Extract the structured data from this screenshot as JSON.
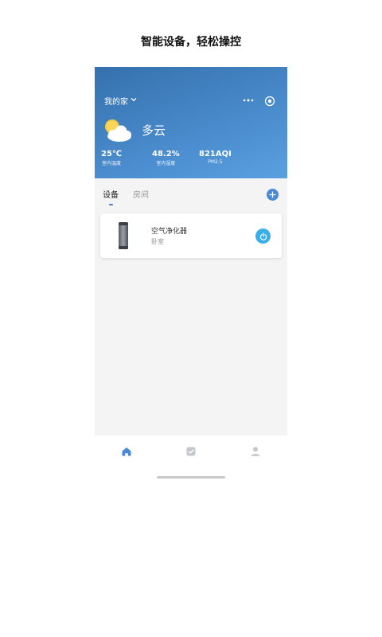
{
  "headline": "智能设备，轻松操控",
  "header": {
    "home_selector": "我的家"
  },
  "weather": {
    "icon": "partly-cloudy-icon",
    "description": "多云",
    "stats": [
      {
        "value": "25℃",
        "label": "室内温度"
      },
      {
        "value": "48.2%",
        "label": "室内湿度"
      },
      {
        "value": "821AQI",
        "label": "PM2.5"
      }
    ]
  },
  "tabs": [
    {
      "label": "设备",
      "active": true
    },
    {
      "label": "房间",
      "active": false
    }
  ],
  "devices": [
    {
      "name": "空气净化器",
      "room": "卧室",
      "power_on": true
    }
  ],
  "bottom_nav": [
    {
      "icon": "home-icon",
      "active": true
    },
    {
      "icon": "task-check-icon",
      "active": false
    },
    {
      "icon": "profile-icon",
      "active": false
    }
  ],
  "colors": {
    "header_gradient_start": "#3570ad",
    "header_gradient_end": "#5aa0e0",
    "accent_blue": "#4a88d8",
    "power_button": "#3aaee8",
    "background": "#f4f4f4"
  }
}
